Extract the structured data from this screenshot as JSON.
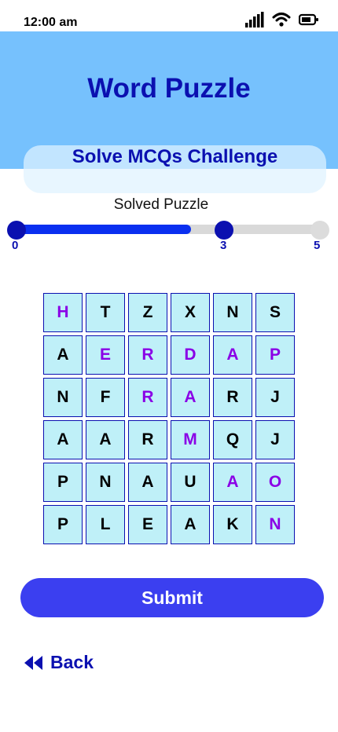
{
  "status_bar": {
    "time": "12:00 am",
    "icons": [
      "signal-icon",
      "wifi-icon",
      "battery-icon"
    ]
  },
  "header": {
    "title": "Word Puzzle",
    "subtitle": "Solve  MCQs Challenge"
  },
  "progress": {
    "label": "Solved Puzzle",
    "min": "0",
    "current": "3",
    "max": "5",
    "fraction": 0.6
  },
  "puzzle": {
    "rows": [
      [
        "H",
        "T",
        "Z",
        "X",
        "N",
        "S"
      ],
      [
        "A",
        "E",
        "R",
        "D",
        "A",
        "P"
      ],
      [
        "N",
        "F",
        "R",
        "A",
        "R",
        "J"
      ],
      [
        "A",
        "A",
        "R",
        "M",
        "Q",
        "J"
      ],
      [
        "P",
        "N",
        "A",
        "U",
        "A",
        "O"
      ],
      [
        "P",
        "L",
        "E",
        "A",
        "K",
        "N"
      ]
    ],
    "found_cells": [
      [
        0,
        0
      ],
      [
        1,
        1
      ],
      [
        1,
        2
      ],
      [
        2,
        2
      ],
      [
        1,
        3
      ],
      [
        2,
        3
      ],
      [
        3,
        3
      ],
      [
        1,
        4
      ],
      [
        4,
        4
      ],
      [
        1,
        5
      ],
      [
        4,
        5
      ],
      [
        5,
        5
      ]
    ]
  },
  "actions": {
    "submit_label": "Submit",
    "back_label": "Back"
  },
  "colors": {
    "header_bg": "#76c1fd",
    "title": "#0b10b0",
    "found_letter": "#8a00e6",
    "cell_bg": "#bff0f8",
    "submit_bg": "#3b3ff0",
    "progress_fill": "#0a2ff0"
  }
}
